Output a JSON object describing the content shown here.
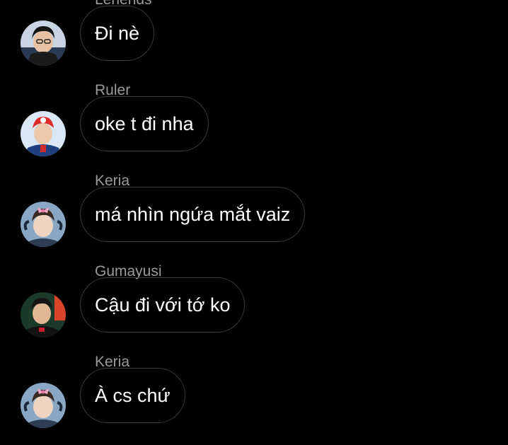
{
  "messages": [
    {
      "sender": "Lehends",
      "text": "Đi nè"
    },
    {
      "sender": "Ruler",
      "text": "oke t đi nha"
    },
    {
      "sender": "Keria",
      "text": "má nhìn ngứa mắt vaiz"
    },
    {
      "sender": "Gumayusi",
      "text": "Cậu đi với tớ ko"
    },
    {
      "sender": "Keria",
      "text": "À cs chứ"
    }
  ],
  "colors": {
    "background": "#000000",
    "sender_name": "#9a9a9a",
    "bubble_border": "#3a3a3a",
    "message_text": "#ffffff"
  }
}
